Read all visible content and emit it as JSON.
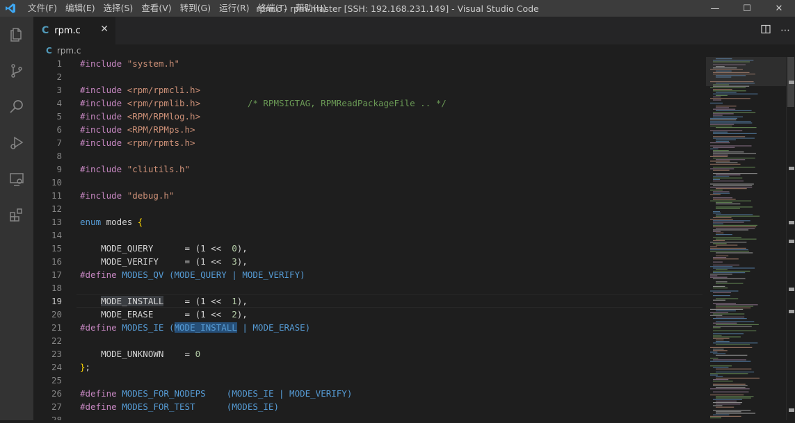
{
  "titlebar": {
    "menu": [
      "文件(F)",
      "编辑(E)",
      "选择(S)",
      "查看(V)",
      "转到(G)",
      "运行(R)",
      "终端(T)",
      "帮助(H)"
    ],
    "title": "rpm.c - rpm-master [SSH: 192.168.231.149] - Visual Studio Code"
  },
  "tab": {
    "label": "rpm.c",
    "icon": "C"
  },
  "breadcrumb": {
    "label": "rpm.c",
    "icon": "C"
  },
  "editor": {
    "lines": [
      [
        {
          "t": "#include ",
          "c": "kw"
        },
        {
          "t": "\"system.h\"",
          "c": "str"
        }
      ],
      [],
      [
        {
          "t": "#include ",
          "c": "kw"
        },
        {
          "t": "<rpm/rpmcli.h>",
          "c": "str"
        }
      ],
      [
        {
          "t": "#include ",
          "c": "kw"
        },
        {
          "t": "<rpm/rpmlib.h>",
          "c": "str"
        },
        {
          "t": "         "
        },
        {
          "t": "/* RPMSIGTAG, RPMReadPackageFile .. */",
          "c": "cmt"
        }
      ],
      [
        {
          "t": "#include ",
          "c": "kw"
        },
        {
          "t": "<RPM/RPMlog.h>",
          "c": "str"
        }
      ],
      [
        {
          "t": "#include ",
          "c": "kw"
        },
        {
          "t": "<RPM/RPMps.h>",
          "c": "str"
        }
      ],
      [
        {
          "t": "#include ",
          "c": "kw"
        },
        {
          "t": "<rpm/rpmts.h>",
          "c": "str"
        }
      ],
      [],
      [
        {
          "t": "#include ",
          "c": "kw"
        },
        {
          "t": "\"cliutils.h\"",
          "c": "str"
        }
      ],
      [],
      [
        {
          "t": "#include ",
          "c": "kw"
        },
        {
          "t": "\"debug.h\"",
          "c": "str"
        }
      ],
      [],
      [
        {
          "t": "enum",
          "c": "tp"
        },
        {
          "t": " modes "
        },
        {
          "t": "{",
          "c": "brk"
        }
      ],
      [],
      [
        {
          "t": "    MODE_QUERY      = (1 <<  "
        },
        {
          "t": "0",
          "c": "num"
        },
        {
          "t": "),"
        }
      ],
      [
        {
          "t": "    MODE_VERIFY     = (1 <<  "
        },
        {
          "t": "3",
          "c": "num"
        },
        {
          "t": "),"
        }
      ],
      [
        {
          "t": "#define ",
          "c": "kw"
        },
        {
          "t": "MODES_QV",
          "c": "mac"
        },
        {
          "t": " (MODE_QUERY | MODE_VERIFY)",
          "c": "mac"
        }
      ],
      [],
      [
        {
          "t": "    "
        },
        {
          "t": "MODE_INSTALL",
          "c": "hl"
        },
        {
          "t": "    = (1 <<  "
        },
        {
          "t": "1",
          "c": "num"
        },
        {
          "t": "),"
        }
      ],
      [
        {
          "t": "    MODE_ERASE      = (1 <<  "
        },
        {
          "t": "2",
          "c": "num"
        },
        {
          "t": "),"
        }
      ],
      [
        {
          "t": "#define ",
          "c": "kw"
        },
        {
          "t": "MODES_IE",
          "c": "mac"
        },
        {
          "t": " (",
          "c": "mac"
        },
        {
          "t": "MODE_INSTALL",
          "c": "mac hl2"
        },
        {
          "t": " | MODE_ERASE)",
          "c": "mac"
        }
      ],
      [],
      [
        {
          "t": "    MODE_UNKNOWN    = "
        },
        {
          "t": "0",
          "c": "num"
        }
      ],
      [
        {
          "t": "}",
          "c": "brk"
        },
        {
          "t": ";"
        }
      ],
      [],
      [
        {
          "t": "#define ",
          "c": "kw"
        },
        {
          "t": "MODES_FOR_NODEPS",
          "c": "mac"
        },
        {
          "t": "    (MODES_IE | MODE_VERIFY)",
          "c": "mac"
        }
      ],
      [
        {
          "t": "#define ",
          "c": "kw"
        },
        {
          "t": "MODES_FOR_TEST",
          "c": "mac"
        },
        {
          "t": "      (MODES_IE)",
          "c": "mac"
        }
      ],
      []
    ],
    "current_line": 19
  }
}
